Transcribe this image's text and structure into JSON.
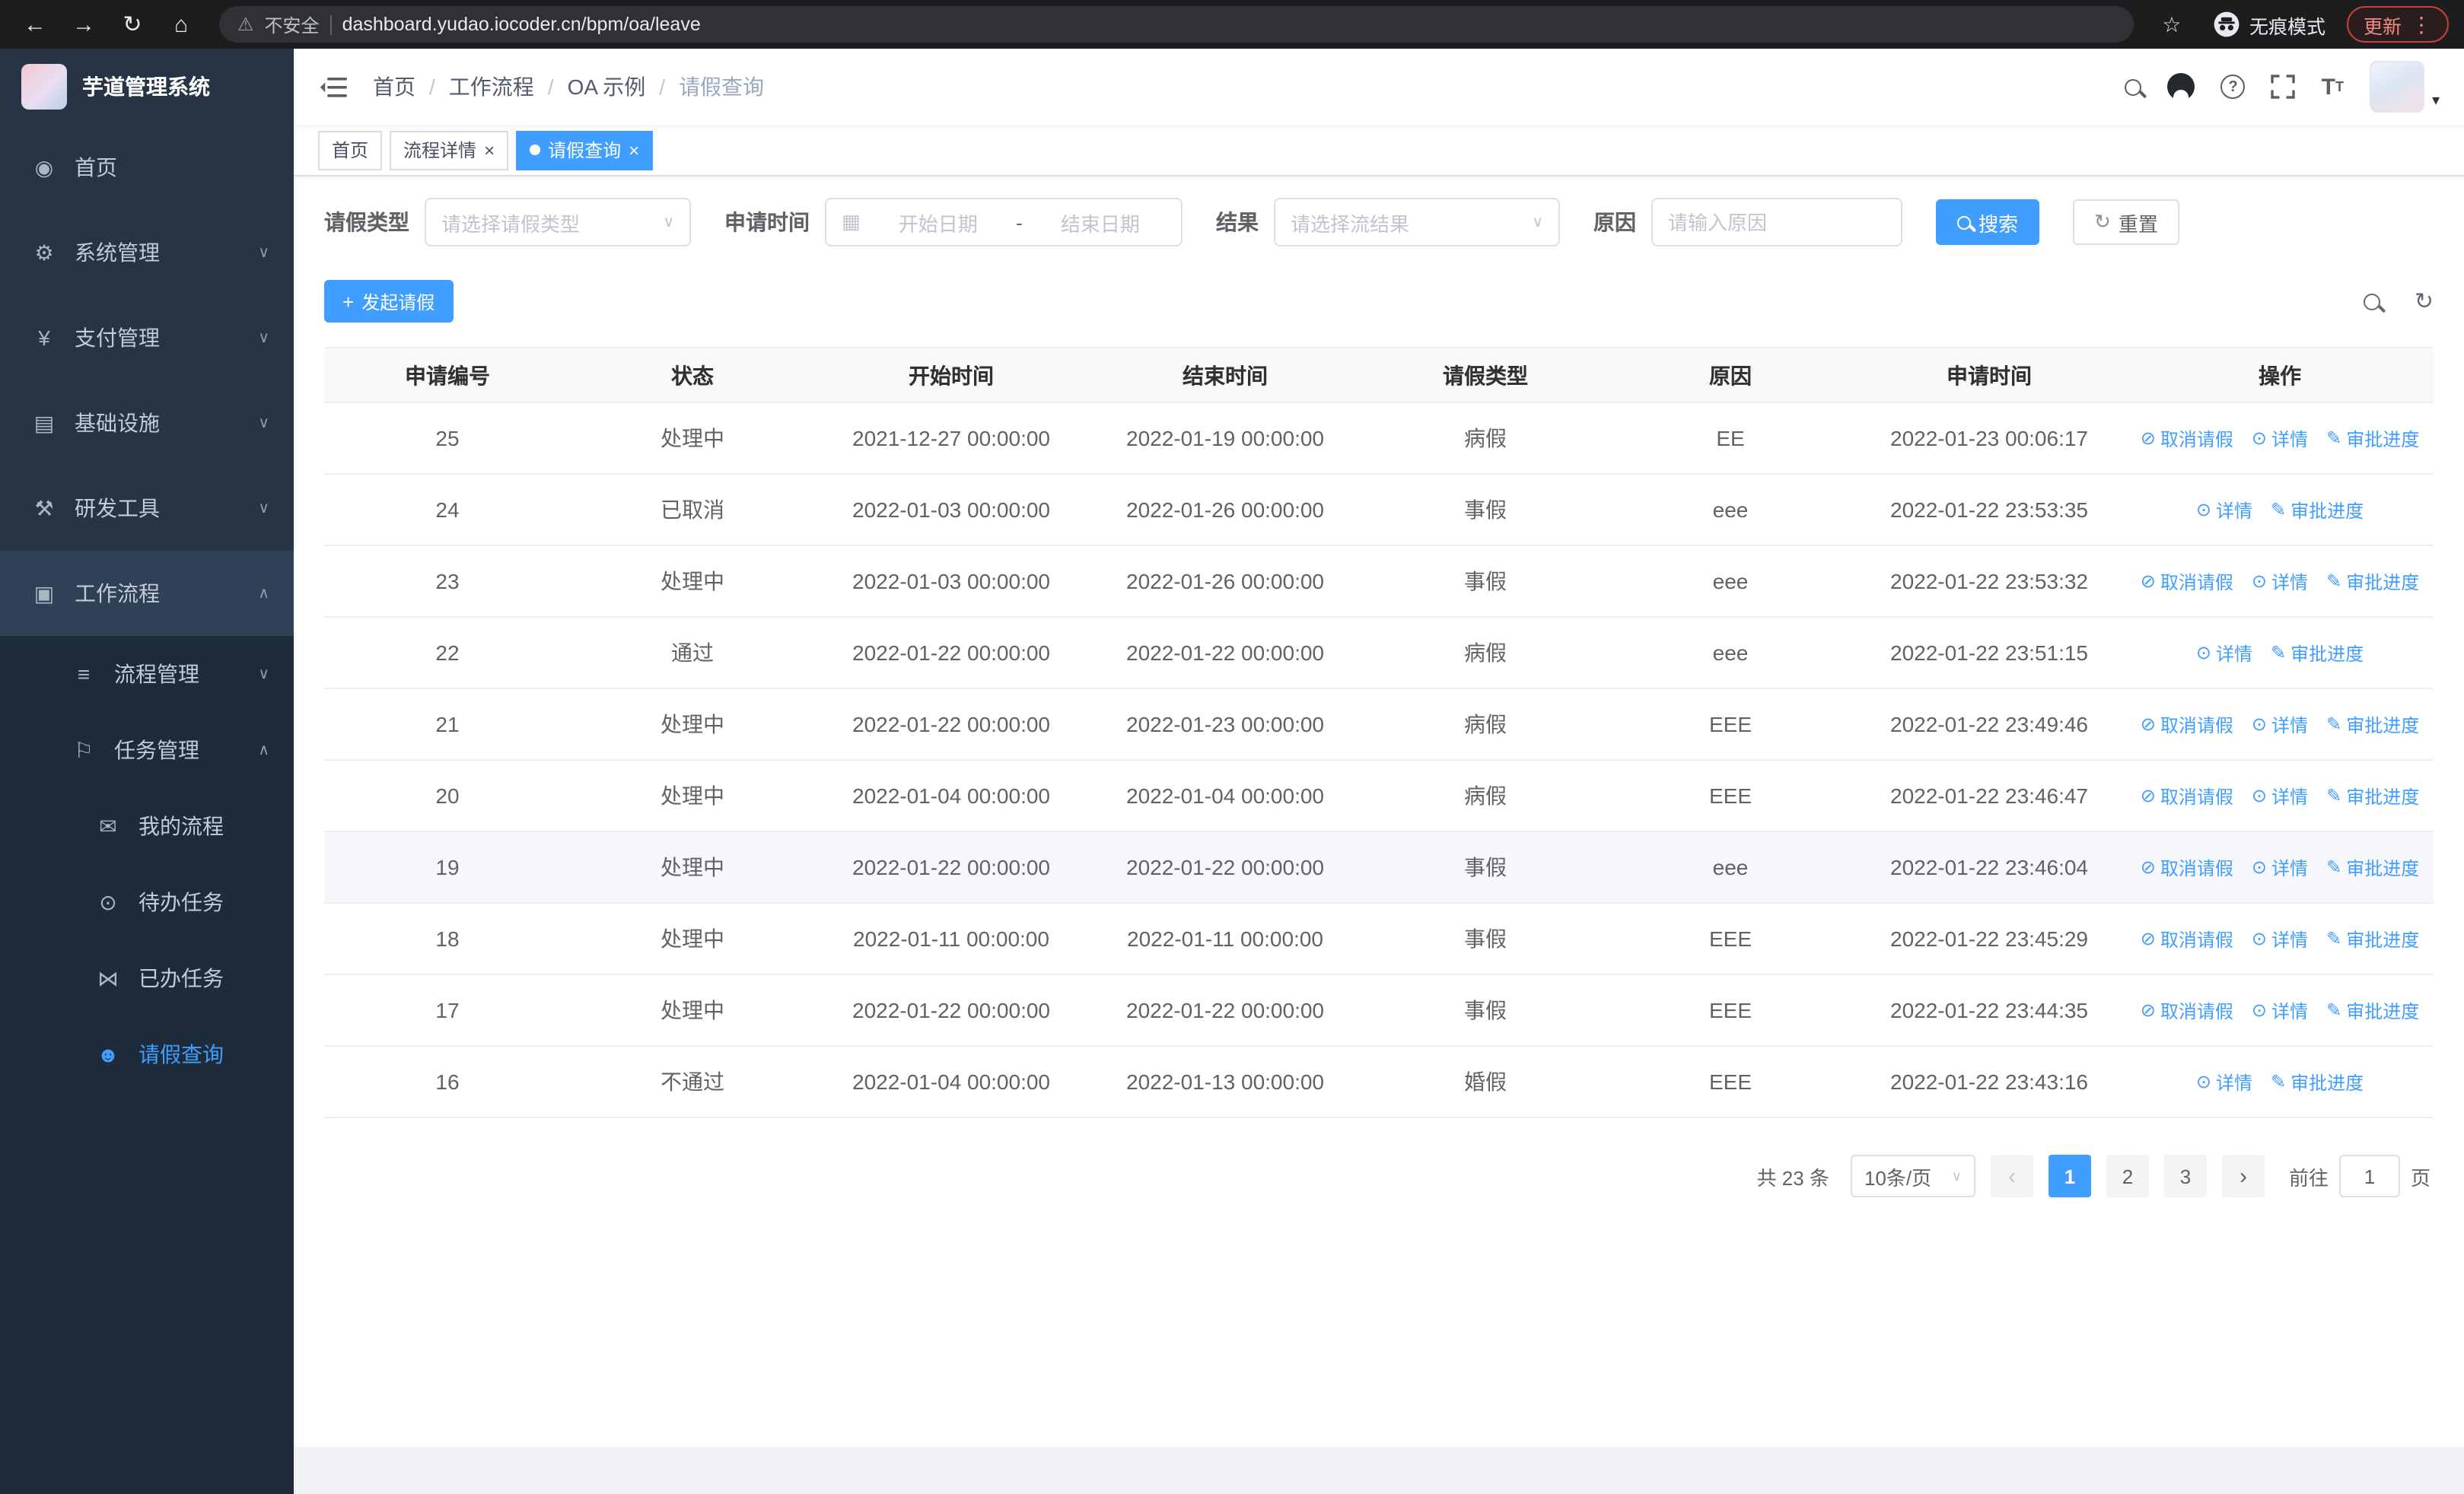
{
  "browser": {
    "url": "dashboard.yudao.iocoder.cn/bpm/oa/leave",
    "security_label": "不安全",
    "incognito_label": "无痕模式",
    "update_label": "更新"
  },
  "icons": {
    "back": "←",
    "forward": "→",
    "reload": "↻",
    "home": "⌂",
    "warning": "⚠",
    "star": "☆",
    "more": "⋮",
    "dashboard": "◉",
    "gear": "⚙",
    "yen": "¥",
    "infra": "▤",
    "tools": "⚒",
    "workflow": "▣",
    "process": "≡",
    "task": "⚐",
    "message": "✉",
    "eye": "⊙",
    "bowtie": "⋈",
    "person": "☻",
    "chevron_down": "∨",
    "chevron_up": "∧",
    "calendar": "▦",
    "plus": "+",
    "refresh": "↻",
    "caret_down": "▾",
    "close": "×",
    "prev": "‹",
    "next": "›",
    "help": "?",
    "action_cancel": "⊘",
    "action_detail": "⊙",
    "action_progress": "✎",
    "search": "css-magnifier",
    "github": "css-circle",
    "fullscreen": "svg-corners",
    "font_size": "T",
    "hamburger": "svg-bars",
    "incognito": "svg-spy"
  },
  "sidebar": {
    "title": "芋道管理系统",
    "items": [
      {
        "label": "首页"
      },
      {
        "label": "系统管理"
      },
      {
        "label": "支付管理"
      },
      {
        "label": "基础设施"
      },
      {
        "label": "研发工具"
      },
      {
        "label": "工作流程"
      },
      {
        "label": "流程管理"
      },
      {
        "label": "任务管理"
      },
      {
        "label": "我的流程"
      },
      {
        "label": "待办任务"
      },
      {
        "label": "已办任务"
      },
      {
        "label": "请假查询"
      }
    ]
  },
  "breadcrumb": {
    "separator": "/",
    "items": [
      "首页",
      "工作流程",
      "OA 示例",
      "请假查询"
    ]
  },
  "tabs": [
    {
      "label": "首页"
    },
    {
      "label": "流程详情"
    },
    {
      "label": "请假查询"
    }
  ],
  "filters": {
    "leave_type_label": "请假类型",
    "leave_type_placeholder": "请选择请假类型",
    "apply_time_label": "申请时间",
    "start_date_placeholder": "开始日期",
    "range_separator": "-",
    "end_date_placeholder": "结束日期",
    "result_label": "结果",
    "result_placeholder": "请选择流结果",
    "reason_label": "原因",
    "reason_placeholder": "请输入原因",
    "search_label": "搜索",
    "reset_label": "重置"
  },
  "toolbar": {
    "create_label": "发起请假"
  },
  "table": {
    "columns": [
      "申请编号",
      "状态",
      "开始时间",
      "结束时间",
      "请假类型",
      "原因",
      "申请时间",
      "操作"
    ],
    "action_labels": {
      "cancel": "取消请假",
      "detail": "详情",
      "progress": "审批进度"
    },
    "rows": [
      {
        "id": "25",
        "status": "处理中",
        "start": "2021-12-27 00:00:00",
        "end": "2022-01-19 00:00:00",
        "type": "病假",
        "reason": "EE",
        "applied": "2022-01-23 00:06:17",
        "actions": [
          "cancel",
          "detail",
          "progress"
        ],
        "hover": false
      },
      {
        "id": "24",
        "status": "已取消",
        "start": "2022-01-03 00:00:00",
        "end": "2022-01-26 00:00:00",
        "type": "事假",
        "reason": "eee",
        "applied": "2022-01-22 23:53:35",
        "actions": [
          "detail",
          "progress"
        ],
        "hover": false
      },
      {
        "id": "23",
        "status": "处理中",
        "start": "2022-01-03 00:00:00",
        "end": "2022-01-26 00:00:00",
        "type": "事假",
        "reason": "eee",
        "applied": "2022-01-22 23:53:32",
        "actions": [
          "cancel",
          "detail",
          "progress"
        ],
        "hover": false
      },
      {
        "id": "22",
        "status": "通过",
        "start": "2022-01-22 00:00:00",
        "end": "2022-01-22 00:00:00",
        "type": "病假",
        "reason": "eee",
        "applied": "2022-01-22 23:51:15",
        "actions": [
          "detail",
          "progress"
        ],
        "hover": false
      },
      {
        "id": "21",
        "status": "处理中",
        "start": "2022-01-22 00:00:00",
        "end": "2022-01-23 00:00:00",
        "type": "病假",
        "reason": "EEE",
        "applied": "2022-01-22 23:49:46",
        "actions": [
          "cancel",
          "detail",
          "progress"
        ],
        "hover": false
      },
      {
        "id": "20",
        "status": "处理中",
        "start": "2022-01-04 00:00:00",
        "end": "2022-01-04 00:00:00",
        "type": "病假",
        "reason": "EEE",
        "applied": "2022-01-22 23:46:47",
        "actions": [
          "cancel",
          "detail",
          "progress"
        ],
        "hover": false
      },
      {
        "id": "19",
        "status": "处理中",
        "start": "2022-01-22 00:00:00",
        "end": "2022-01-22 00:00:00",
        "type": "事假",
        "reason": "eee",
        "applied": "2022-01-22 23:46:04",
        "actions": [
          "cancel",
          "detail",
          "progress"
        ],
        "hover": true
      },
      {
        "id": "18",
        "status": "处理中",
        "start": "2022-01-11 00:00:00",
        "end": "2022-01-11 00:00:00",
        "type": "事假",
        "reason": "EEE",
        "applied": "2022-01-22 23:45:29",
        "actions": [
          "cancel",
          "detail",
          "progress"
        ],
        "hover": false
      },
      {
        "id": "17",
        "status": "处理中",
        "start": "2022-01-22 00:00:00",
        "end": "2022-01-22 00:00:00",
        "type": "事假",
        "reason": "EEE",
        "applied": "2022-01-22 23:44:35",
        "actions": [
          "cancel",
          "detail",
          "progress"
        ],
        "hover": false
      },
      {
        "id": "16",
        "status": "不通过",
        "start": "2022-01-04 00:00:00",
        "end": "2022-01-13 00:00:00",
        "type": "婚假",
        "reason": "EEE",
        "applied": "2022-01-22 23:43:16",
        "actions": [
          "detail",
          "progress"
        ],
        "hover": false
      }
    ]
  },
  "pagination": {
    "total_text": "共 23 条",
    "page_size": "10条/页",
    "pages": [
      "1",
      "2",
      "3"
    ],
    "current": "1",
    "goto_prefix": "前往",
    "goto_value": "1",
    "goto_suffix": "页"
  }
}
